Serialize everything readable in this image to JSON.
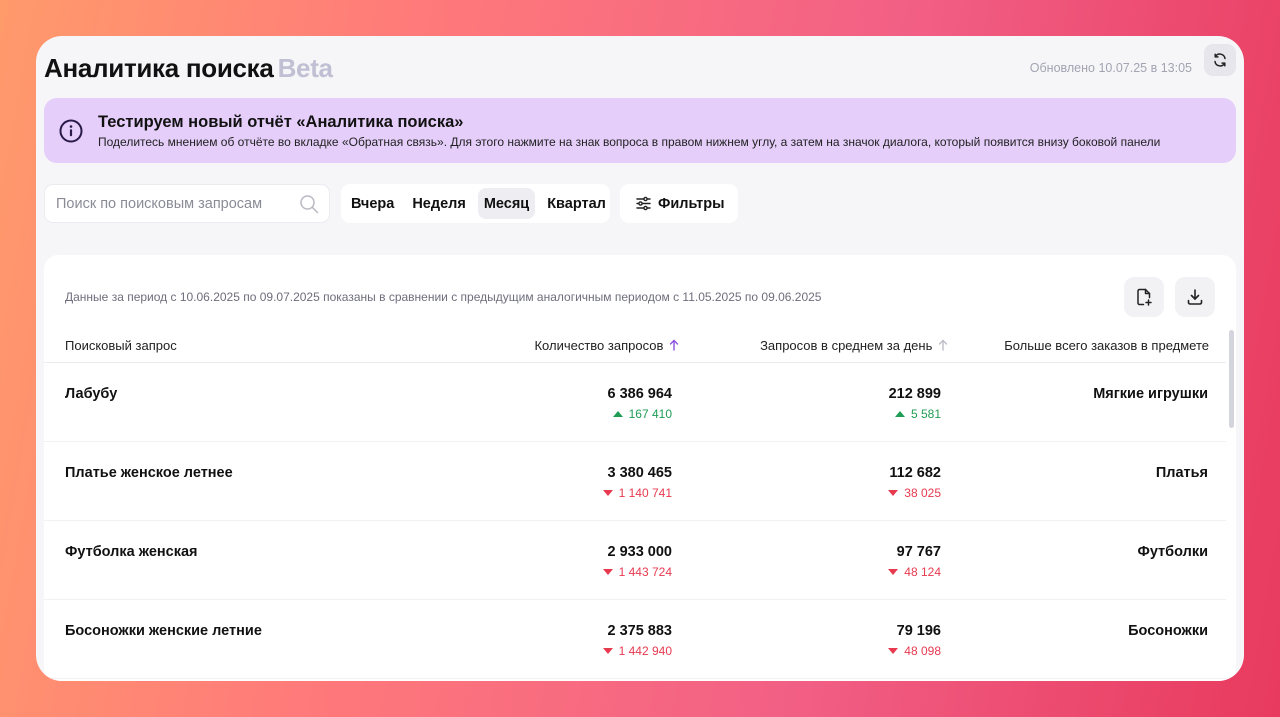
{
  "header": {
    "title": "Аналитика поиска",
    "beta": "Beta",
    "updated": "Обновлено 10.07.25 в 13:05"
  },
  "banner": {
    "title": "Тестируем новый отчёт «Аналитика поиска»",
    "text": "Поделитесь мнением об отчёте во вкладке «Обратная связь». Для этого нажмите на знак вопроса в правом нижнем углу, а затем на значок диалога, который появится внизу боковой панели"
  },
  "search": {
    "placeholder": "Поиск по поисковым запросам"
  },
  "periods": [
    {
      "label": "Вчера",
      "active": false
    },
    {
      "label": "Неделя",
      "active": false
    },
    {
      "label": "Месяц",
      "active": true
    },
    {
      "label": "Квартал",
      "active": false
    }
  ],
  "filters_label": "Фильтры",
  "table": {
    "period_note": "Данные за период с 10.06.2025 по 09.07.2025 показаны в сравнении с предыдущим аналогичным периодом с 11.05.2025 по 09.06.2025",
    "columns": {
      "query": "Поисковый запрос",
      "count": "Количество запросов",
      "avg": "Запросов в среднем за день",
      "subject": "Больше всего заказов в предмете"
    },
    "rows": [
      {
        "query": "Лабубу",
        "count": "6 386 964",
        "count_delta": "167 410",
        "count_dir": "up",
        "avg": "212 899",
        "avg_delta": "5 581",
        "avg_dir": "up",
        "subject": "Мягкие игрушки"
      },
      {
        "query": "Платье женское летнее",
        "count": "3 380 465",
        "count_delta": "1 140 741",
        "count_dir": "down",
        "avg": "112 682",
        "avg_delta": "38 025",
        "avg_dir": "down",
        "subject": "Платья"
      },
      {
        "query": "Футболка женская",
        "count": "2 933 000",
        "count_delta": "1 443 724",
        "count_dir": "down",
        "avg": "97 767",
        "avg_delta": "48 124",
        "avg_dir": "down",
        "subject": "Футболки"
      },
      {
        "query": "Босоножки женские летние",
        "count": "2 375 883",
        "count_delta": "1 442 940",
        "count_dir": "down",
        "avg": "79 196",
        "avg_delta": "48 098",
        "avg_dir": "down",
        "subject": "Босоножки"
      }
    ]
  },
  "colors": {
    "accent": "#7a3cc9",
    "up": "#1f9d55",
    "down": "#e8394f",
    "banner_bg": "#e5cefa"
  }
}
